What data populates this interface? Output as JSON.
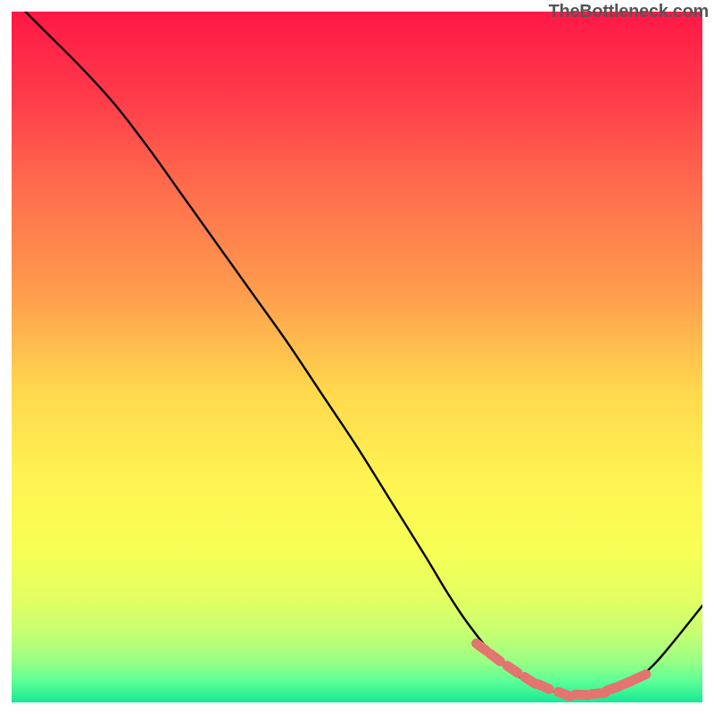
{
  "watermark": {
    "text": "TheBottleneck.com"
  },
  "chart_data": {
    "type": "line",
    "title": "",
    "xlabel": "",
    "ylabel": "",
    "xlim": [
      0,
      100
    ],
    "ylim": [
      0,
      100
    ],
    "grid": false,
    "series": [
      {
        "name": "bottleneck-curve",
        "color": "#000000",
        "x": [
          2,
          5,
          10,
          15,
          20,
          25,
          30,
          35,
          40,
          45,
          50,
          55,
          60,
          63,
          66,
          70,
          73,
          76,
          80,
          83,
          86,
          90,
          93,
          96,
          100
        ],
        "y": [
          100,
          97,
          92,
          86.5,
          80,
          73,
          66,
          59,
          52,
          44.5,
          37,
          29,
          21,
          16,
          11.5,
          6.5,
          4,
          2.5,
          1.2,
          1,
          1.2,
          3,
          5.5,
          9,
          14
        ]
      },
      {
        "name": "highlight-dots",
        "color": "#e3746f",
        "type": "scatter",
        "x": [
          68,
          70,
          72.5,
          75,
          77,
          80,
          82.5,
          85,
          87,
          89,
          91
        ],
        "y": [
          8,
          6.5,
          4.8,
          3.2,
          2.3,
          1.2,
          1.1,
          1.3,
          2,
          2.8,
          3.7
        ]
      }
    ],
    "background_gradient": {
      "stops": [
        {
          "offset": 0.0,
          "color": "#ff1846"
        },
        {
          "offset": 0.12,
          "color": "#ff3a4a"
        },
        {
          "offset": 0.25,
          "color": "#ff6b4d"
        },
        {
          "offset": 0.4,
          "color": "#ff9a4d"
        },
        {
          "offset": 0.55,
          "color": "#ffd84e"
        },
        {
          "offset": 0.68,
          "color": "#fff451"
        },
        {
          "offset": 0.78,
          "color": "#f7ff55"
        },
        {
          "offset": 0.85,
          "color": "#e2ff62"
        },
        {
          "offset": 0.9,
          "color": "#c6ff72"
        },
        {
          "offset": 0.94,
          "color": "#9aff84"
        },
        {
          "offset": 0.97,
          "color": "#5bff97"
        },
        {
          "offset": 1.0,
          "color": "#17e896"
        }
      ]
    }
  }
}
